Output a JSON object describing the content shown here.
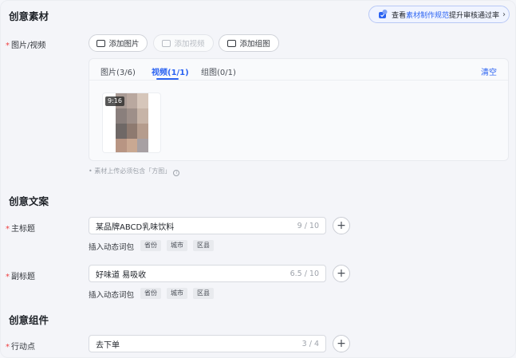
{
  "creative_material": {
    "title": "创意素材",
    "guide": {
      "prefix": "查看",
      "link": "素材制作规范",
      "suffix": "提升审核通过率",
      "chevron": "›"
    },
    "media_field": {
      "required_mark": "*",
      "label": "图片/视频",
      "buttons": {
        "add_image": "添加图片",
        "add_video": "添加视频",
        "add_group": "添加组图"
      },
      "tabs": [
        {
          "label": "图片(3/6)",
          "active": false
        },
        {
          "label": "视频(1/1)",
          "active": true
        },
        {
          "label": "组图(0/1)",
          "active": false
        }
      ],
      "clear_label": "清空",
      "video_duration": "9:16"
    },
    "hint": "素材上传必须包含「方图」",
    "hint_icon": "i"
  },
  "creative_copy": {
    "title": "创意文案",
    "main_title": {
      "required_mark": "*",
      "label": "主标题",
      "value": "某品牌ABCD乳味饮料",
      "count": "9 / 10"
    },
    "sub_title": {
      "required_mark": "*",
      "label": "副标题",
      "value": "好味道 易吸收",
      "count": "6.5 / 10"
    },
    "keywords_label": "插入动态词包",
    "keyword_tags": [
      "省份",
      "城市",
      "区县"
    ],
    "plus_symbol": "+"
  },
  "creative_component": {
    "title": "创意组件",
    "action": {
      "required_mark": "*",
      "label": "行动点",
      "value": "去下单",
      "count": "3 / 4"
    }
  },
  "colors": {
    "accent": "#2b63f2",
    "required": "#f04142",
    "panel_bg": "#f4f5f9"
  },
  "icons": [
    "guide-icon",
    "image-icon",
    "video-icon",
    "folder-icon",
    "info-icon",
    "plus-icon"
  ]
}
